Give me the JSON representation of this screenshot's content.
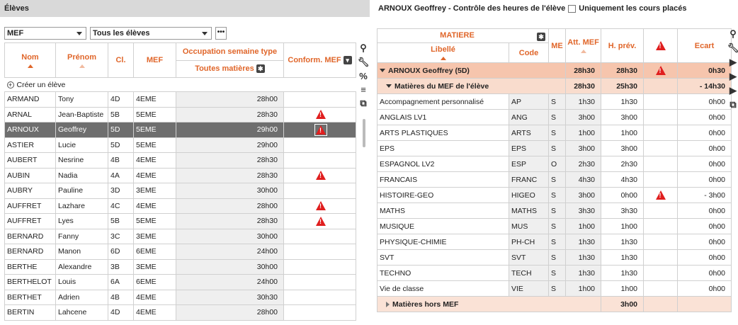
{
  "left": {
    "title": "Élèves",
    "filter1": "MEF",
    "filter2": "Tous les élèves",
    "more": "•••",
    "headers": {
      "nom": "Nom",
      "prenom": "Prénom",
      "classe": "Cl.",
      "mef": "MEF",
      "occupation": "Occupation semaine type",
      "toutes": "Toutes matières",
      "conform": "Conform. MEF"
    },
    "create": "Créer un élève",
    "rows": [
      {
        "nom": "ARMAND",
        "prenom": "Tony",
        "cl": "4D",
        "mef": "4EME",
        "occ": "28h00",
        "warn": false
      },
      {
        "nom": "ARNAL",
        "prenom": "Jean-Baptiste",
        "cl": "5B",
        "mef": "5EME",
        "occ": "28h30",
        "warn": true
      },
      {
        "nom": "ARNOUX",
        "prenom": "Geoffrey",
        "cl": "5D",
        "mef": "5EME",
        "occ": "29h00",
        "warn": true
      },
      {
        "nom": "ASTIER",
        "prenom": "Lucie",
        "cl": "5D",
        "mef": "5EME",
        "occ": "29h00",
        "warn": false
      },
      {
        "nom": "AUBERT",
        "prenom": "Nesrine",
        "cl": "4B",
        "mef": "4EME",
        "occ": "28h30",
        "warn": false
      },
      {
        "nom": "AUBIN",
        "prenom": "Nadia",
        "cl": "4A",
        "mef": "4EME",
        "occ": "28h30",
        "warn": true
      },
      {
        "nom": "AUBRY",
        "prenom": "Pauline",
        "cl": "3D",
        "mef": "3EME",
        "occ": "30h00",
        "warn": false
      },
      {
        "nom": "AUFFRET",
        "prenom": "Lazhare",
        "cl": "4C",
        "mef": "4EME",
        "occ": "28h00",
        "warn": true
      },
      {
        "nom": "AUFFRET",
        "prenom": "Lyes",
        "cl": "5B",
        "mef": "5EME",
        "occ": "28h30",
        "warn": true
      },
      {
        "nom": "BERNARD",
        "prenom": "Fanny",
        "cl": "3C",
        "mef": "3EME",
        "occ": "30h00",
        "warn": false
      },
      {
        "nom": "BERNARD",
        "prenom": "Manon",
        "cl": "6D",
        "mef": "6EME",
        "occ": "24h00",
        "warn": false
      },
      {
        "nom": "BERTHE",
        "prenom": "Alexandre",
        "cl": "3B",
        "mef": "3EME",
        "occ": "30h00",
        "warn": false
      },
      {
        "nom": "BERTHELOT",
        "prenom": "Louis",
        "cl": "6A",
        "mef": "6EME",
        "occ": "24h00",
        "warn": false
      },
      {
        "nom": "BERTHET",
        "prenom": "Adrien",
        "cl": "4B",
        "mef": "4EME",
        "occ": "30h30",
        "warn": false
      },
      {
        "nom": "BERTIN",
        "prenom": "Lahcene",
        "cl": "4D",
        "mef": "4EME",
        "occ": "28h00",
        "warn": false
      }
    ]
  },
  "right": {
    "title": "ARNOUX Geoffrey - Contrôle des heures de l'élève",
    "checkbox_label": "Uniquement les cours placés",
    "headers": {
      "matiere": "MATIERE",
      "libelle": "Libellé",
      "code": "Code",
      "me": "ME",
      "att": "Att. MEF",
      "hprev": "H. prév.",
      "ecart": "Ecart"
    },
    "group1": {
      "label": "ARNOUX Geoffrey (5D)",
      "att": "28h30",
      "hprev": "28h30",
      "ecart": "0h30"
    },
    "group2": {
      "label": "Matières du MEF de l'élève",
      "att": "28h30",
      "hprev": "25h30",
      "ecart": "- 14h30"
    },
    "rows": [
      {
        "lib": "Accompagnement personnalisé",
        "code": "AP",
        "me": "S",
        "att": "1h30",
        "hprev": "1h30",
        "warn": false,
        "ecart": "0h00"
      },
      {
        "lib": "ANGLAIS LV1",
        "code": "ANG",
        "me": "S",
        "att": "3h00",
        "hprev": "3h00",
        "warn": false,
        "ecart": "0h00"
      },
      {
        "lib": "ARTS PLASTIQUES",
        "code": "ARTS",
        "me": "S",
        "att": "1h00",
        "hprev": "1h00",
        "warn": false,
        "ecart": "0h00"
      },
      {
        "lib": "EPS",
        "code": "EPS",
        "me": "S",
        "att": "3h00",
        "hprev": "3h00",
        "warn": false,
        "ecart": "0h00"
      },
      {
        "lib": "ESPAGNOL LV2",
        "code": "ESP",
        "me": "O",
        "att": "2h30",
        "hprev": "2h30",
        "warn": false,
        "ecart": "0h00"
      },
      {
        "lib": "FRANCAIS",
        "code": "FRANC",
        "me": "S",
        "att": "4h30",
        "hprev": "4h30",
        "warn": false,
        "ecart": "0h00"
      },
      {
        "lib": "HISTOIRE-GEO",
        "code": "HIGEO",
        "me": "S",
        "att": "3h00",
        "hprev": "0h00",
        "warn": true,
        "ecart": "- 3h00"
      },
      {
        "lib": "MATHS",
        "code": "MATHS",
        "me": "S",
        "att": "3h30",
        "hprev": "3h30",
        "warn": false,
        "ecart": "0h00"
      },
      {
        "lib": "MUSIQUE",
        "code": "MUS",
        "me": "S",
        "att": "1h00",
        "hprev": "1h00",
        "warn": false,
        "ecart": "0h00"
      },
      {
        "lib": "PHYSIQUE-CHIMIE",
        "code": "PH-CH",
        "me": "S",
        "att": "1h30",
        "hprev": "1h30",
        "warn": false,
        "ecart": "0h00"
      },
      {
        "lib": "SVT",
        "code": "SVT",
        "me": "S",
        "att": "1h30",
        "hprev": "1h30",
        "warn": false,
        "ecart": "0h00"
      },
      {
        "lib": "TECHNO",
        "code": "TECH",
        "me": "S",
        "att": "1h30",
        "hprev": "1h30",
        "warn": false,
        "ecart": "0h00"
      },
      {
        "lib": "Vie de classe",
        "code": "VIE",
        "me": "S",
        "att": "1h00",
        "hprev": "1h00",
        "warn": false,
        "ecart": "0h00"
      }
    ],
    "group3": {
      "label": "Matières hors MEF",
      "hprev": "3h00"
    }
  },
  "colors": {
    "accent": "#e0662a",
    "warn": "#e01e1e",
    "selected": "#6e6e6e"
  }
}
